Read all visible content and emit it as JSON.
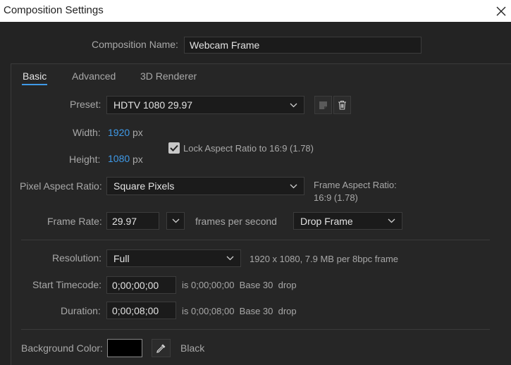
{
  "window": {
    "title": "Composition Settings"
  },
  "comp_name": {
    "label": "Composition Name:",
    "value": "Webcam Frame"
  },
  "tabs": [
    {
      "label": "Basic",
      "active": true
    },
    {
      "label": "Advanced"
    },
    {
      "label": "3D Renderer"
    }
  ],
  "preset": {
    "label": "Preset:",
    "value": "HDTV 1080 29.97"
  },
  "width": {
    "label": "Width:",
    "value": "1920",
    "unit": "px"
  },
  "height": {
    "label": "Height:",
    "value": "1080",
    "unit": "px"
  },
  "lock_aspect": {
    "label": "Lock Aspect Ratio to 16:9 (1.78)",
    "checked": true
  },
  "pixel_aspect": {
    "label": "Pixel Aspect Ratio:",
    "value": "Square Pixels"
  },
  "frame_aspect": {
    "label": "Frame Aspect Ratio:",
    "value": "16:9 (1.78)"
  },
  "frame_rate": {
    "label": "Frame Rate:",
    "value": "29.97",
    "unit": "frames per second",
    "drop": "Drop Frame"
  },
  "resolution": {
    "label": "Resolution:",
    "value": "Full",
    "info": "1920 x 1080, 7.9 MB per 8bpc frame"
  },
  "start_timecode": {
    "label": "Start Timecode:",
    "value": "0;00;00;00",
    "info": "is 0;00;00;00  Base 30  drop"
  },
  "duration": {
    "label": "Duration:",
    "value": "0;00;08;00",
    "info": "is 0;00;08;00  Base 30  drop"
  },
  "background": {
    "label": "Background Color:",
    "name": "Black",
    "color": "#000000"
  },
  "colors": {
    "accent": "#3f9ae8",
    "panel": "#262626",
    "field": "#1b1b1b"
  }
}
